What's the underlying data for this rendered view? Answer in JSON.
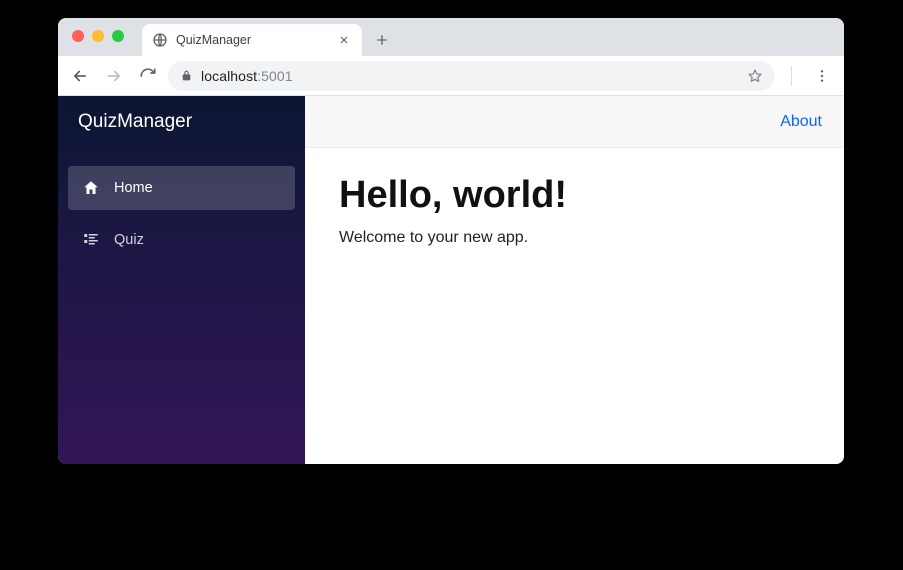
{
  "browser": {
    "tab": {
      "title": "QuizManager"
    },
    "url": {
      "host": "localhost",
      "port": ":5001"
    }
  },
  "app": {
    "brand": "QuizManager",
    "sidebar": {
      "items": [
        {
          "label": "Home",
          "icon": "home-icon",
          "active": true
        },
        {
          "label": "Quiz",
          "icon": "list-icon",
          "active": false
        }
      ]
    },
    "topbar": {
      "about_label": "About"
    },
    "content": {
      "heading": "Hello, world!",
      "subtext": "Welcome to your new app."
    }
  }
}
